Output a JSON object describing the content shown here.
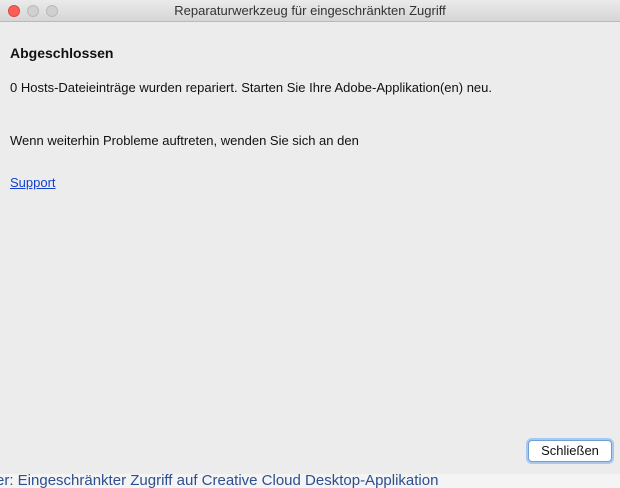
{
  "window": {
    "title": "Reparaturwerkzeug für eingeschränkten Zugriff"
  },
  "content": {
    "heading": "Abgeschlossen",
    "message": "0 Hosts-Dateieinträge wurden repariert. Starten Sie Ihre Adobe-Applikation(en) neu.",
    "help_text": "Wenn weiterhin Probleme auftreten, wenden Sie sich an den",
    "support_link": "Support"
  },
  "buttons": {
    "close_label": "Schließen"
  },
  "background": {
    "partial_text": "er: Eingeschränkter Zugriff auf Creative Cloud Desktop-Applikation"
  }
}
